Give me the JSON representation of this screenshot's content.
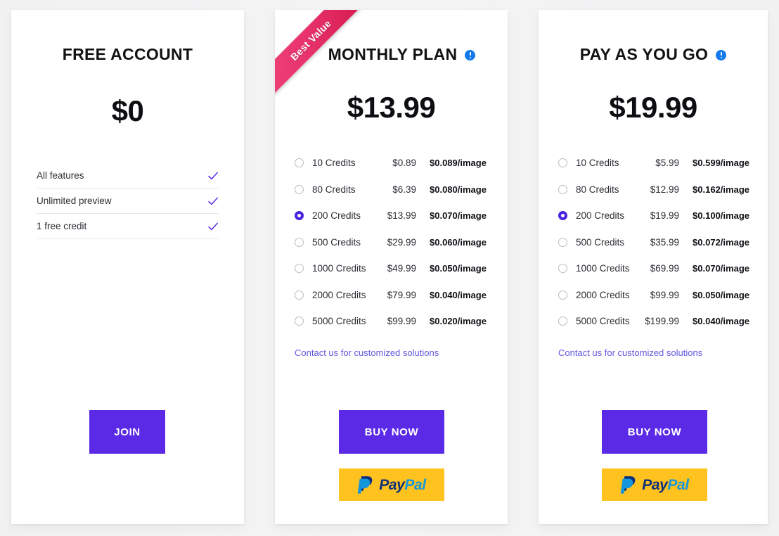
{
  "colors": {
    "background": "#f2f2f3",
    "card": "#ffffff",
    "accent_purple": "#5b2ae6",
    "radio_selected": "#4a23de",
    "link_purple": "#6358e0",
    "check_purple": "#5b2ae6",
    "info_blue": "#1479ec",
    "ribbon_pink": "#e8336c",
    "ribbon_dark": "#a30e36",
    "paypal_yellow": "#ffc21f",
    "paypal_dark_blue": "#0d2f7d",
    "paypal_light_blue": "#1496dc"
  },
  "plans": [
    {
      "id": "free-account",
      "title": "FREE ACCOUNT",
      "price": "$0",
      "has_info_icon": false,
      "ribbon": null,
      "features": [
        {
          "label": "All features",
          "checked": true
        },
        {
          "label": "Unlimited preview",
          "checked": true
        },
        {
          "label": "1 free credit",
          "checked": true
        }
      ],
      "options": [],
      "contact_link": null,
      "cta_label": "JOIN",
      "paypal": false
    },
    {
      "id": "monthly-plan",
      "title": "MONTHLY PLAN",
      "price": "$13.99",
      "has_info_icon": true,
      "ribbon": "Best Value",
      "features": [],
      "options": [
        {
          "credits": "10 Credits",
          "price": "$0.89",
          "unit": "$0.089/image",
          "selected": false
        },
        {
          "credits": "80 Credits",
          "price": "$6.39",
          "unit": "$0.080/image",
          "selected": false
        },
        {
          "credits": "200 Credits",
          "price": "$13.99",
          "unit": "$0.070/image",
          "selected": true
        },
        {
          "credits": "500 Credits",
          "price": "$29.99",
          "unit": "$0.060/image",
          "selected": false
        },
        {
          "credits": "1000 Credits",
          "price": "$49.99",
          "unit": "$0.050/image",
          "selected": false
        },
        {
          "credits": "2000 Credits",
          "price": "$79.99",
          "unit": "$0.040/image",
          "selected": false
        },
        {
          "credits": "5000 Credits",
          "price": "$99.99",
          "unit": "$0.020/image",
          "selected": false
        }
      ],
      "contact_link": "Contact us for customized solutions",
      "cta_label": "BUY NOW",
      "paypal": true,
      "paypal_text_1": "Pay",
      "paypal_text_2": "Pal"
    },
    {
      "id": "pay-as-you-go",
      "title": "PAY AS YOU GO",
      "price": "$19.99",
      "has_info_icon": true,
      "ribbon": null,
      "features": [],
      "options": [
        {
          "credits": "10 Credits",
          "price": "$5.99",
          "unit": "$0.599/image",
          "selected": false
        },
        {
          "credits": "80 Credits",
          "price": "$12.99",
          "unit": "$0.162/image",
          "selected": false
        },
        {
          "credits": "200 Credits",
          "price": "$19.99",
          "unit": "$0.100/image",
          "selected": true
        },
        {
          "credits": "500 Credits",
          "price": "$35.99",
          "unit": "$0.072/image",
          "selected": false
        },
        {
          "credits": "1000 Credits",
          "price": "$69.99",
          "unit": "$0.070/image",
          "selected": false
        },
        {
          "credits": "2000 Credits",
          "price": "$99.99",
          "unit": "$0.050/image",
          "selected": false
        },
        {
          "credits": "5000 Credits",
          "price": "$199.99",
          "unit": "$0.040/image",
          "selected": false
        }
      ],
      "contact_link": "Contact us for customized solutions",
      "cta_label": "BUY NOW",
      "paypal": true,
      "paypal_text_1": "Pay",
      "paypal_text_2": "Pal"
    }
  ],
  "icons": {
    "info": "info-icon",
    "check": "check-icon",
    "radio": "radio-icon",
    "paypal": "paypal-logo-icon"
  }
}
